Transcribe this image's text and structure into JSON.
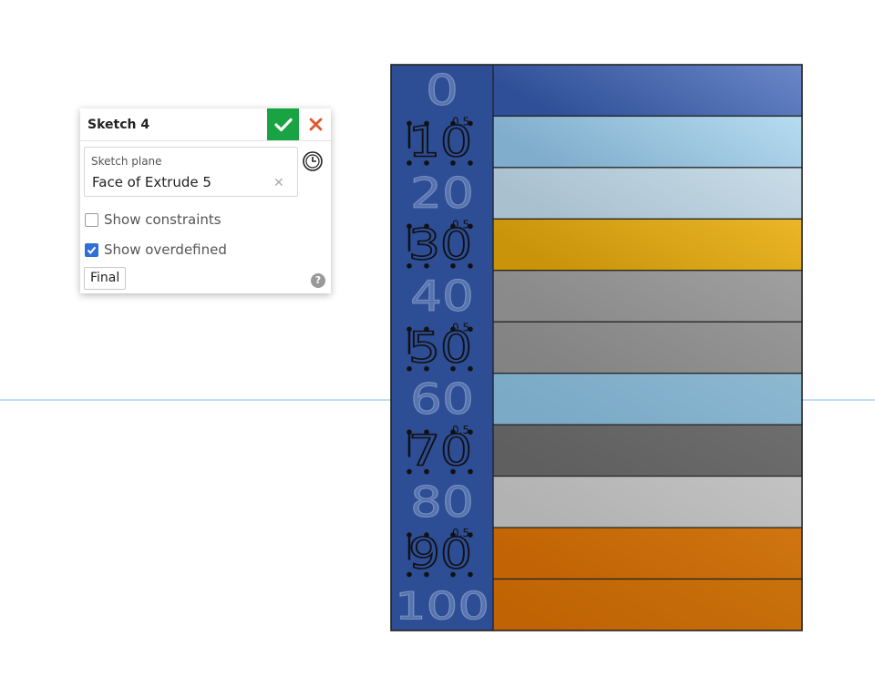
{
  "dialog": {
    "title": "Sketch 4",
    "sketch_plane_label": "Sketch plane",
    "sketch_plane_value": "Face of Extrude 5",
    "show_constraints_label": "Show constraints",
    "show_constraints_checked": false,
    "show_overdefined_label": "Show overdefined",
    "show_overdefined_checked": true,
    "final_label": "Final",
    "accept_color": "#1aa342",
    "cancel_color": "#e0552b"
  },
  "model": {
    "labels": [
      "0",
      "10",
      "20",
      "30",
      "40",
      "50",
      "60",
      "70",
      "80",
      "90",
      "100"
    ],
    "sketch_marks": [
      "0.5",
      "0.5",
      "0.5",
      "0.5",
      "0.5"
    ],
    "stripe_colors": [
      [
        "#2f4f98",
        "#6a88c8"
      ],
      [
        "#80adcc",
        "#b7dcf1"
      ],
      [
        "#a9c0cf",
        "#c9dde8"
      ],
      [
        "#c9930a",
        "#eab728"
      ],
      [
        "#8a8a8a",
        "#a0a0a0"
      ],
      [
        "#838383",
        "#979797"
      ],
      [
        "#7aaac6",
        "#8db8d2"
      ],
      [
        "#5f5f5f",
        "#6e6e6e"
      ],
      [
        "#b2b2b2",
        "#c3c3c3"
      ],
      [
        "#c26405",
        "#d07512"
      ],
      [
        "#c06304",
        "#c8720d"
      ]
    ],
    "label_column_color": "#2d4d95"
  }
}
